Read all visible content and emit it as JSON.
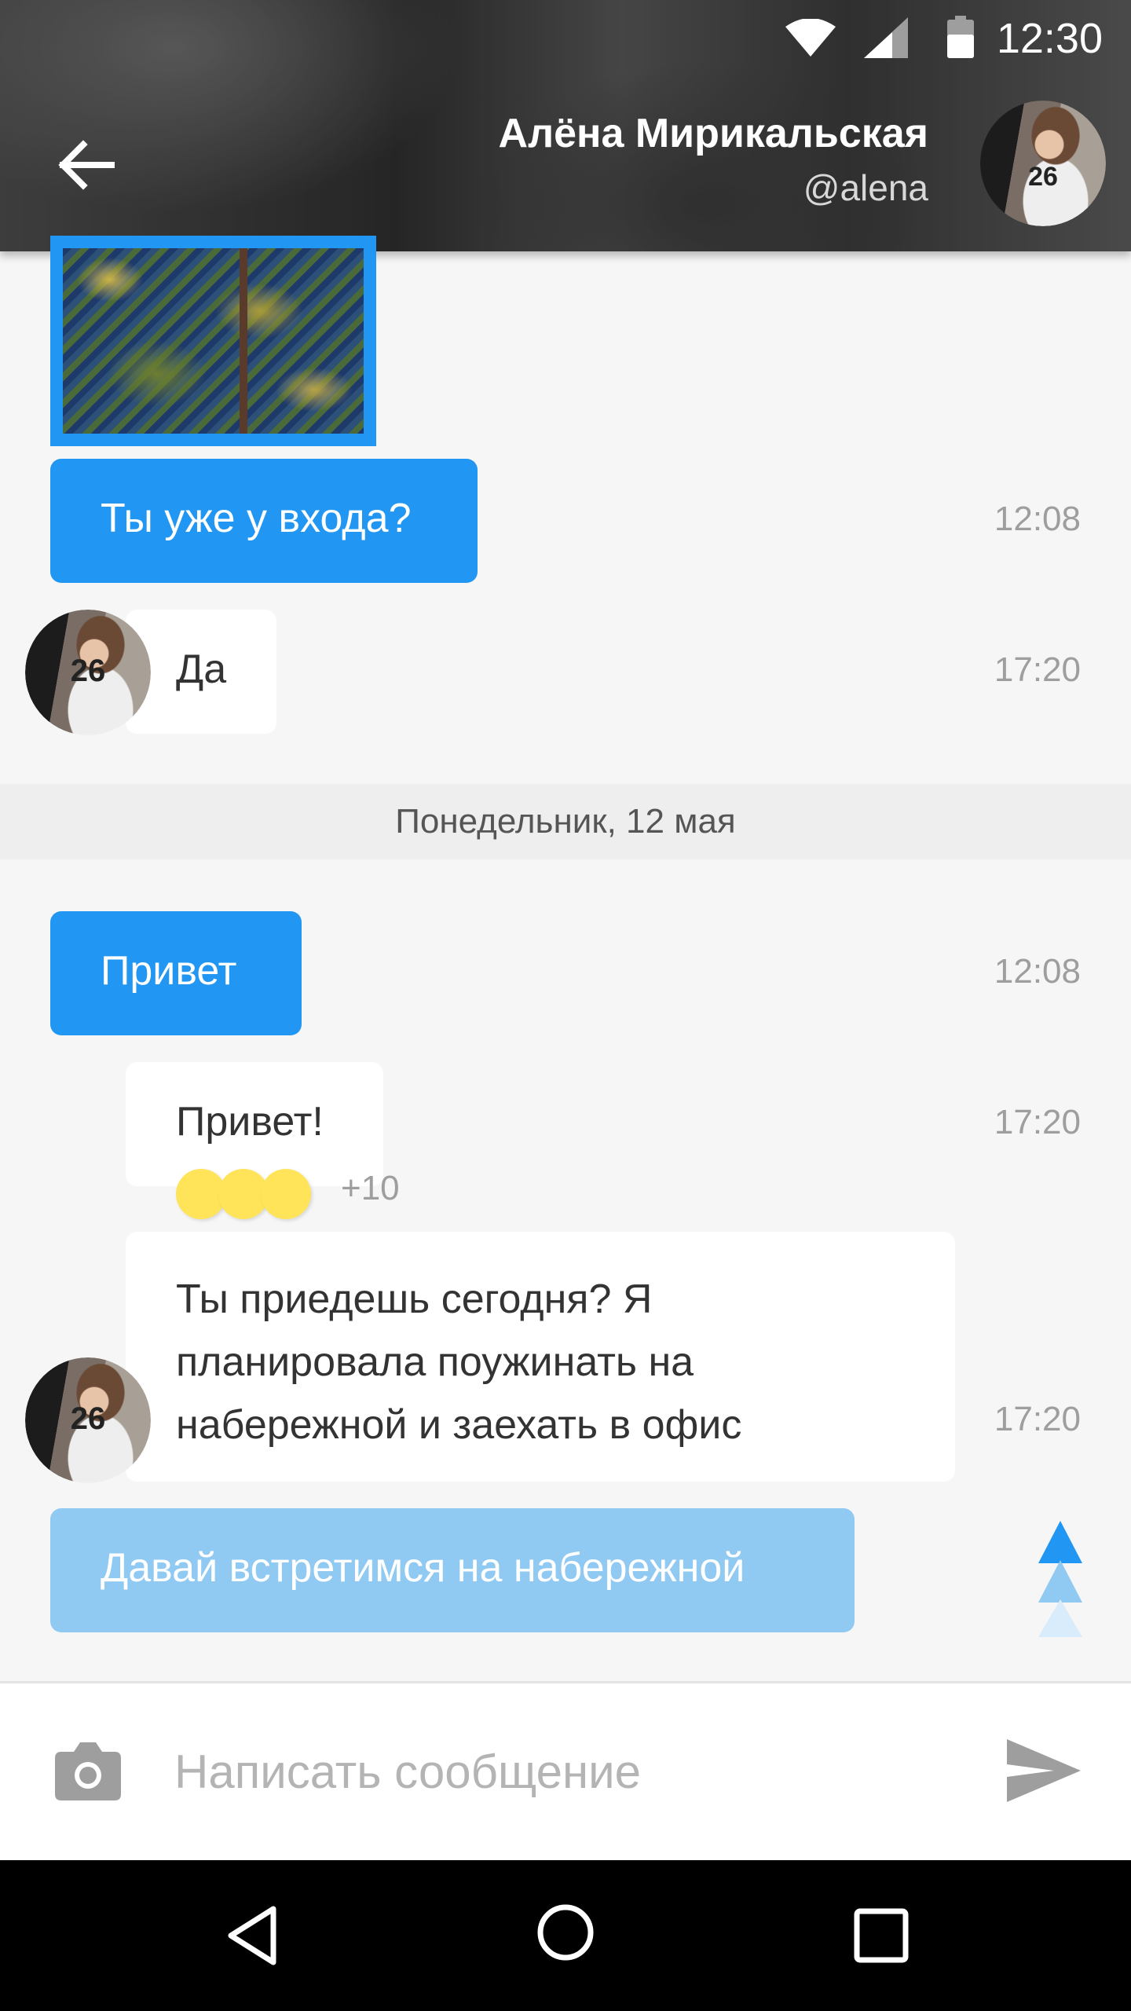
{
  "status_bar": {
    "time": "12:30",
    "icons": [
      "wifi-icon",
      "signal-icon",
      "battery-icon"
    ]
  },
  "header": {
    "back_icon": "back-arrow-icon",
    "contact_name": "Алёна Мирикальская",
    "contact_username": "@alena",
    "avatar_number": "26"
  },
  "messages": [
    {
      "type": "photo",
      "direction": "outgoing",
      "time": "12:08"
    },
    {
      "type": "text",
      "direction": "outgoing",
      "text": "Ты уже у входа?",
      "time": "12:08"
    },
    {
      "type": "text",
      "direction": "incoming",
      "text": "Да",
      "time": "17:20"
    },
    {
      "type": "date_divider",
      "text": "Понедельник, 12 мая"
    },
    {
      "type": "text",
      "direction": "outgoing",
      "text": "Привет",
      "time": "12:08"
    },
    {
      "type": "text",
      "direction": "incoming",
      "text": "Привет!",
      "time": "17:20",
      "reactions": {
        "count_label": "+10"
      }
    },
    {
      "type": "text",
      "direction": "incoming",
      "lines": [
        "Ты приедешь сегодня? Я",
        "планировала поужинать на",
        "набережной и заехать в офис"
      ],
      "time": "17:20"
    },
    {
      "type": "text",
      "direction": "outgoing",
      "status": "sending",
      "text": "Давай встретимся на набережной"
    }
  ],
  "composer": {
    "placeholder": "Написать сообщение",
    "camera_icon": "camera-icon",
    "send_icon": "send-icon"
  },
  "nav_bar": {
    "icons": [
      "nav-back-icon",
      "nav-home-icon",
      "nav-recent-icon"
    ]
  },
  "colors": {
    "accent": "#2196f3",
    "pending_bubble": "#90caf3",
    "incoming_bubble": "#ffffff",
    "background": "#f6f6f6",
    "divider": "#eeeeee",
    "reaction": "#ffe45a"
  }
}
